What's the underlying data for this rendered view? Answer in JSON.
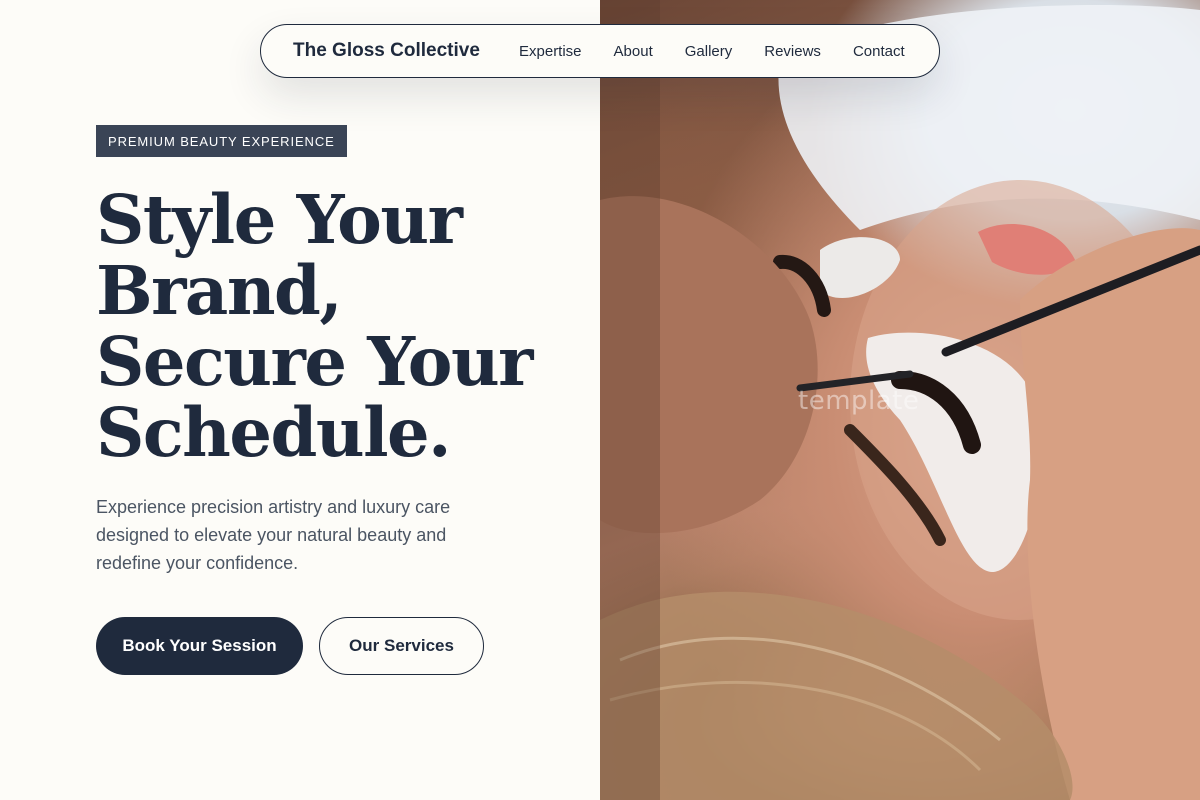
{
  "nav": {
    "brand": "The Gloss Collective",
    "links": [
      "Expertise",
      "About",
      "Gallery",
      "Reviews",
      "Contact"
    ]
  },
  "hero": {
    "badge": "PREMIUM BEAUTY EXPERIENCE",
    "headline_lines": [
      "Style Your",
      "Brand,",
      "Secure Your",
      "Schedule."
    ],
    "lead_lines": [
      "Experience precision artistry and luxury care",
      "designed to elevate your natural beauty and",
      "redefine your confidence."
    ],
    "primary_button": "Book Your Session",
    "secondary_button": "Our Services"
  },
  "image": {
    "watermark": "template"
  },
  "colors": {
    "background": "#fdfcf8",
    "navy": "#1f2a3d",
    "badge": "#3a4456",
    "body_text": "#4b5563"
  }
}
